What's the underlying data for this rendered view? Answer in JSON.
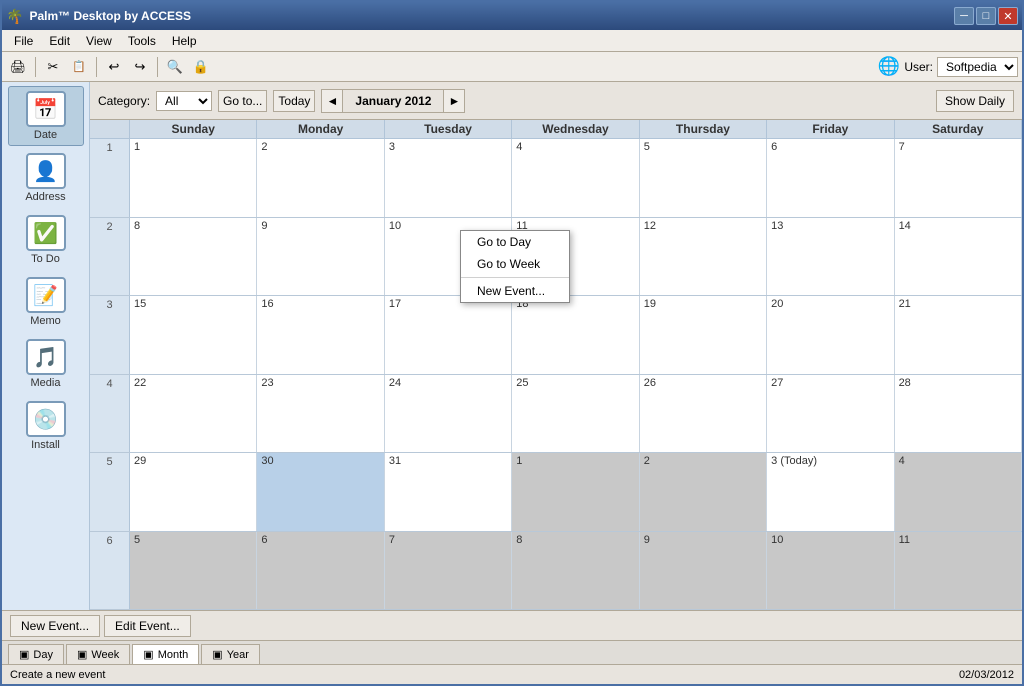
{
  "window": {
    "title": "Palm™ Desktop by ACCESS",
    "title_icon": "🌴"
  },
  "title_controls": {
    "minimize": "─",
    "maximize": "□",
    "close": "✕"
  },
  "menu": {
    "items": [
      "File",
      "Edit",
      "View",
      "Tools",
      "Help"
    ]
  },
  "toolbar": {
    "buttons": [
      "🖨",
      "✂",
      "📋",
      "↩",
      "↪",
      "🔍",
      "🔒"
    ],
    "user_label": "User:",
    "user_name": "Softpedia"
  },
  "calendar": {
    "category_label": "Category:",
    "category_value": "All",
    "goto_label": "Go to...",
    "today_label": "Today",
    "month_title": "January 2012",
    "show_daily_label": "Show Daily",
    "day_headers": [
      "Sunday",
      "Monday",
      "Tuesday",
      "Wednesday",
      "Thursday",
      "Friday",
      "Saturday"
    ],
    "weeks": [
      {
        "week_num": "1",
        "days": [
          {
            "num": "1",
            "type": "current"
          },
          {
            "num": "2",
            "type": "current"
          },
          {
            "num": "3",
            "type": "current"
          },
          {
            "num": "4",
            "type": "current"
          },
          {
            "num": "5",
            "type": "current"
          },
          {
            "num": "6",
            "type": "current"
          },
          {
            "num": "7",
            "type": "current"
          }
        ]
      },
      {
        "week_num": "2",
        "days": [
          {
            "num": "8",
            "type": "current"
          },
          {
            "num": "9",
            "type": "current"
          },
          {
            "num": "10",
            "type": "current"
          },
          {
            "num": "11",
            "type": "current"
          },
          {
            "num": "12",
            "type": "current"
          },
          {
            "num": "13",
            "type": "current"
          },
          {
            "num": "14",
            "type": "current"
          }
        ]
      },
      {
        "week_num": "3",
        "days": [
          {
            "num": "15",
            "type": "current"
          },
          {
            "num": "16",
            "type": "current"
          },
          {
            "num": "17",
            "type": "current"
          },
          {
            "num": "18",
            "type": "current"
          },
          {
            "num": "19",
            "type": "current"
          },
          {
            "num": "20",
            "type": "current"
          },
          {
            "num": "21",
            "type": "current"
          }
        ]
      },
      {
        "week_num": "4",
        "days": [
          {
            "num": "22",
            "type": "current"
          },
          {
            "num": "23",
            "type": "current"
          },
          {
            "num": "24",
            "type": "current"
          },
          {
            "num": "25",
            "type": "current"
          },
          {
            "num": "26",
            "type": "current"
          },
          {
            "num": "27",
            "type": "current"
          },
          {
            "num": "28",
            "type": "current"
          }
        ]
      },
      {
        "week_num": "5",
        "days": [
          {
            "num": "29",
            "type": "current"
          },
          {
            "num": "30",
            "type": "selected"
          },
          {
            "num": "31",
            "type": "current"
          },
          {
            "num": "1",
            "type": "other"
          },
          {
            "num": "2",
            "type": "other"
          },
          {
            "num": "3 (Today)",
            "type": "today"
          },
          {
            "num": "4",
            "type": "other"
          }
        ]
      },
      {
        "week_num": "6",
        "days": [
          {
            "num": "5",
            "type": "other"
          },
          {
            "num": "6",
            "type": "other"
          },
          {
            "num": "7",
            "type": "other"
          },
          {
            "num": "8",
            "type": "other"
          },
          {
            "num": "9",
            "type": "other"
          },
          {
            "num": "10",
            "type": "other"
          },
          {
            "num": "11",
            "type": "other"
          }
        ]
      }
    ]
  },
  "context_menu": {
    "items": [
      "Go to Day",
      "Go to Week",
      "New Event..."
    ],
    "separator_after": 1
  },
  "sidebar": {
    "items": [
      {
        "label": "Date",
        "icon": "📅"
      },
      {
        "label": "Address",
        "icon": "👤"
      },
      {
        "label": "To Do",
        "icon": "✅"
      },
      {
        "label": "Memo",
        "icon": "📝"
      },
      {
        "label": "Media",
        "icon": "🎵"
      },
      {
        "label": "Install",
        "icon": "💿"
      }
    ]
  },
  "bottom_buttons": {
    "new_event": "New Event...",
    "edit_event": "Edit Event..."
  },
  "tabs": {
    "items": [
      {
        "label": "Day",
        "icon": "▣"
      },
      {
        "label": "Week",
        "icon": "▣"
      },
      {
        "label": "Month",
        "icon": "▣",
        "active": true
      },
      {
        "label": "Year",
        "icon": "▣"
      }
    ]
  },
  "status_bar": {
    "message": "Create a new event",
    "date": "02/03/2012"
  }
}
